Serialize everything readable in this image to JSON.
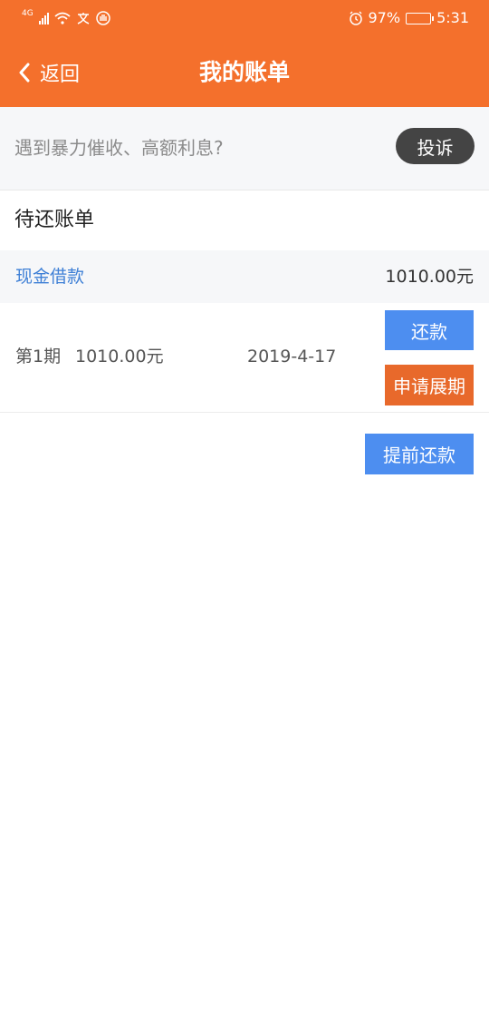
{
  "status_bar": {
    "network": "4G",
    "battery": "97%",
    "battery_level": 0.97,
    "time": "5:31",
    "icons": [
      "signal-icon",
      "wifi-icon",
      "translate-icon",
      "hand-icon",
      "alarm-icon",
      "battery-icon"
    ]
  },
  "nav": {
    "back_label": "返回",
    "title": "我的账单"
  },
  "complaint": {
    "text": "遇到暴力催收、高额利息?",
    "button": "投诉"
  },
  "pending": {
    "section_title": "待还账单",
    "loan_type": "现金借款",
    "loan_amount": "1010.00元"
  },
  "installment": {
    "period": "第1期",
    "amount": "1010.00元",
    "date": "2019-4-17",
    "repay_button": "还款",
    "extend_button": "申请展期"
  },
  "early_repay_button": "提前还款",
  "colors": {
    "header": "#f4702c",
    "primary_button": "#4d8ef0",
    "extend_button": "#e8692b",
    "complain_button": "#444444",
    "link": "#3f80d6"
  }
}
